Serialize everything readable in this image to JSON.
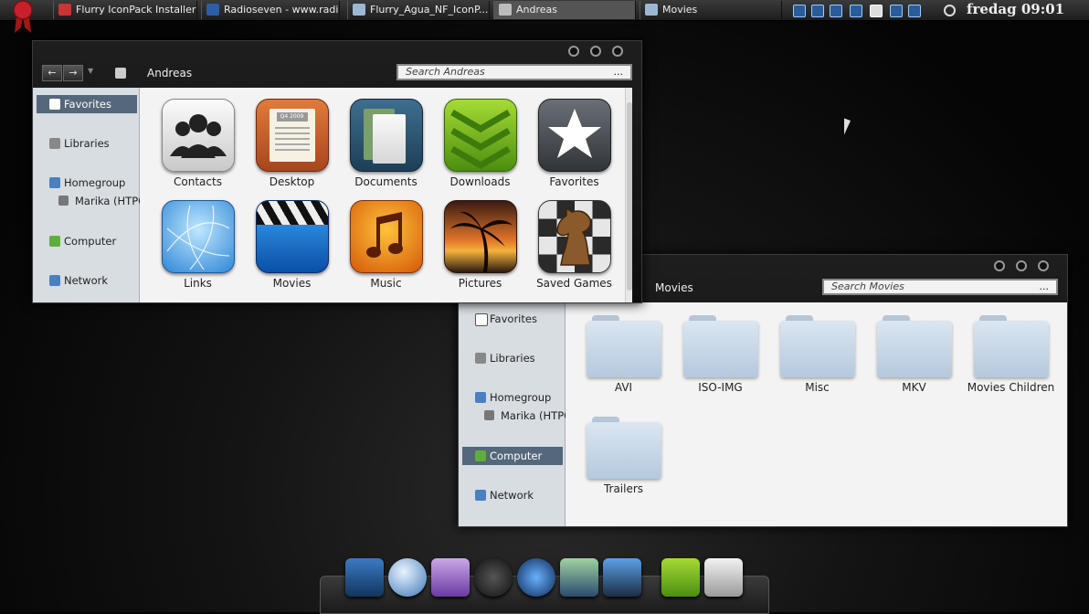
{
  "taskbar": {
    "tasks": [
      {
        "label": "Flurry IconPack Installer ...",
        "icon": "installer-icon"
      },
      {
        "label": "Radioseven - www.radi...",
        "icon": "radio-icon"
      },
      {
        "label": "Flurry_Agua_NF_IconP...",
        "icon": "folder-icon"
      },
      {
        "label": "Andreas",
        "icon": "user-folder-icon"
      },
      {
        "label": "Movies",
        "icon": "folder-icon"
      }
    ],
    "active_task": "Andreas",
    "clock": "fredag 09:01"
  },
  "window_andreas": {
    "breadcrumb": "Andreas",
    "search_placeholder": "Search Andreas",
    "search_menu": "...",
    "nav": {
      "favorites": "Favorites",
      "libraries": "Libraries",
      "homegroup": "Homegroup",
      "homegroup_member": "Marika (HTPC",
      "computer": "Computer",
      "network": "Network"
    },
    "selected_nav": "Favorites",
    "items": [
      {
        "label": "Contacts",
        "icon": "contacts-icon"
      },
      {
        "label": "Desktop",
        "icon": "desktop-icon"
      },
      {
        "label": "Documents",
        "icon": "documents-icon"
      },
      {
        "label": "Downloads",
        "icon": "downloads-icon"
      },
      {
        "label": "Favorites",
        "icon": "favorites-star-icon"
      },
      {
        "label": "Links",
        "icon": "links-icon"
      },
      {
        "label": "Movies",
        "icon": "movies-clapper-icon"
      },
      {
        "label": "Music",
        "icon": "music-note-icon"
      },
      {
        "label": "Pictures",
        "icon": "pictures-palm-icon"
      },
      {
        "label": "Saved Games",
        "icon": "chess-knight-icon"
      }
    ],
    "desktop_icon_text": "Q4 2009"
  },
  "window_movies": {
    "breadcrumb": "Movies",
    "search_placeholder": "Search Movies",
    "search_menu": "...",
    "nav": {
      "favorites": "Favorites",
      "libraries": "Libraries",
      "homegroup": "Homegroup",
      "homegroup_member": "Marika (HTPC",
      "computer": "Computer",
      "network": "Network"
    },
    "selected_nav": "Computer",
    "folders": [
      "AVI",
      "ISO-IMG",
      "Misc",
      "MKV",
      "Movies Children",
      "Trailers"
    ]
  },
  "dock": {
    "items": [
      "file-manager-icon",
      "globe-icon",
      "download-icon",
      "headphones-icon",
      "music-disc-icon",
      "photos-icon",
      "video-icon",
      "downloads-chevron-icon",
      "recycle-bin-icon"
    ]
  },
  "colors": {
    "selection": "#54677b",
    "nav_bg": "#d8dde2",
    "content_bg": "#f3f3f3",
    "window_chrome": "#161616"
  }
}
